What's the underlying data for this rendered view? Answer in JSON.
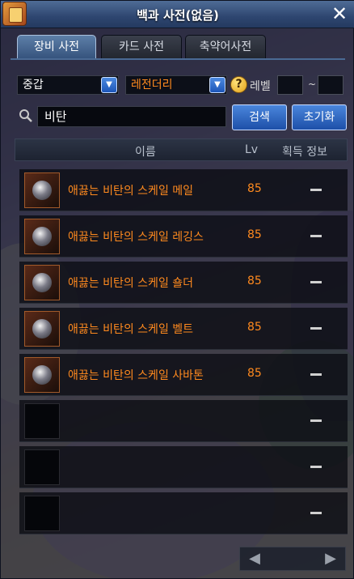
{
  "window": {
    "title": "백과 사전(없음)",
    "close_label": "✕"
  },
  "tabs": [
    {
      "label": "장비 사전",
      "active": true
    },
    {
      "label": "카드 사전",
      "active": false
    },
    {
      "label": "축약어사전",
      "active": false
    }
  ],
  "filters": {
    "type_selected": "중갑",
    "rarity_selected": "레전더리",
    "help_glyph": "?",
    "level_label": "레벨",
    "level_min": "",
    "level_max": "",
    "range_separator": "~"
  },
  "search": {
    "value": "비탄",
    "search_button": "검색",
    "reset_button": "초기화"
  },
  "table": {
    "columns": [
      "이름",
      "Lv",
      "획득 정보"
    ],
    "rows": [
      {
        "name": "애끓는 비탄의 스케일 메일",
        "lv": "85",
        "info": "—",
        "has_item": true
      },
      {
        "name": "애끓는 비탄의 스케일 레깅스",
        "lv": "85",
        "info": "—",
        "has_item": true
      },
      {
        "name": "애끓는 비탄의 스케일 숄더",
        "lv": "85",
        "info": "—",
        "has_item": true
      },
      {
        "name": "애끓는 비탄의 스케일 벨트",
        "lv": "85",
        "info": "—",
        "has_item": true
      },
      {
        "name": "애끓는 비탄의 스케일 사바톤",
        "lv": "85",
        "info": "—",
        "has_item": true
      },
      {
        "name": "",
        "lv": "",
        "info": "—",
        "has_item": false
      },
      {
        "name": "",
        "lv": "",
        "info": "—",
        "has_item": false
      },
      {
        "name": "",
        "lv": "",
        "info": "—",
        "has_item": false
      }
    ]
  },
  "pager": {
    "prev": "◀",
    "next": "▶"
  },
  "colors": {
    "item_name": "#ff8a1e",
    "button_blue": "#2a66c4",
    "title_bar": "#2e4670"
  }
}
